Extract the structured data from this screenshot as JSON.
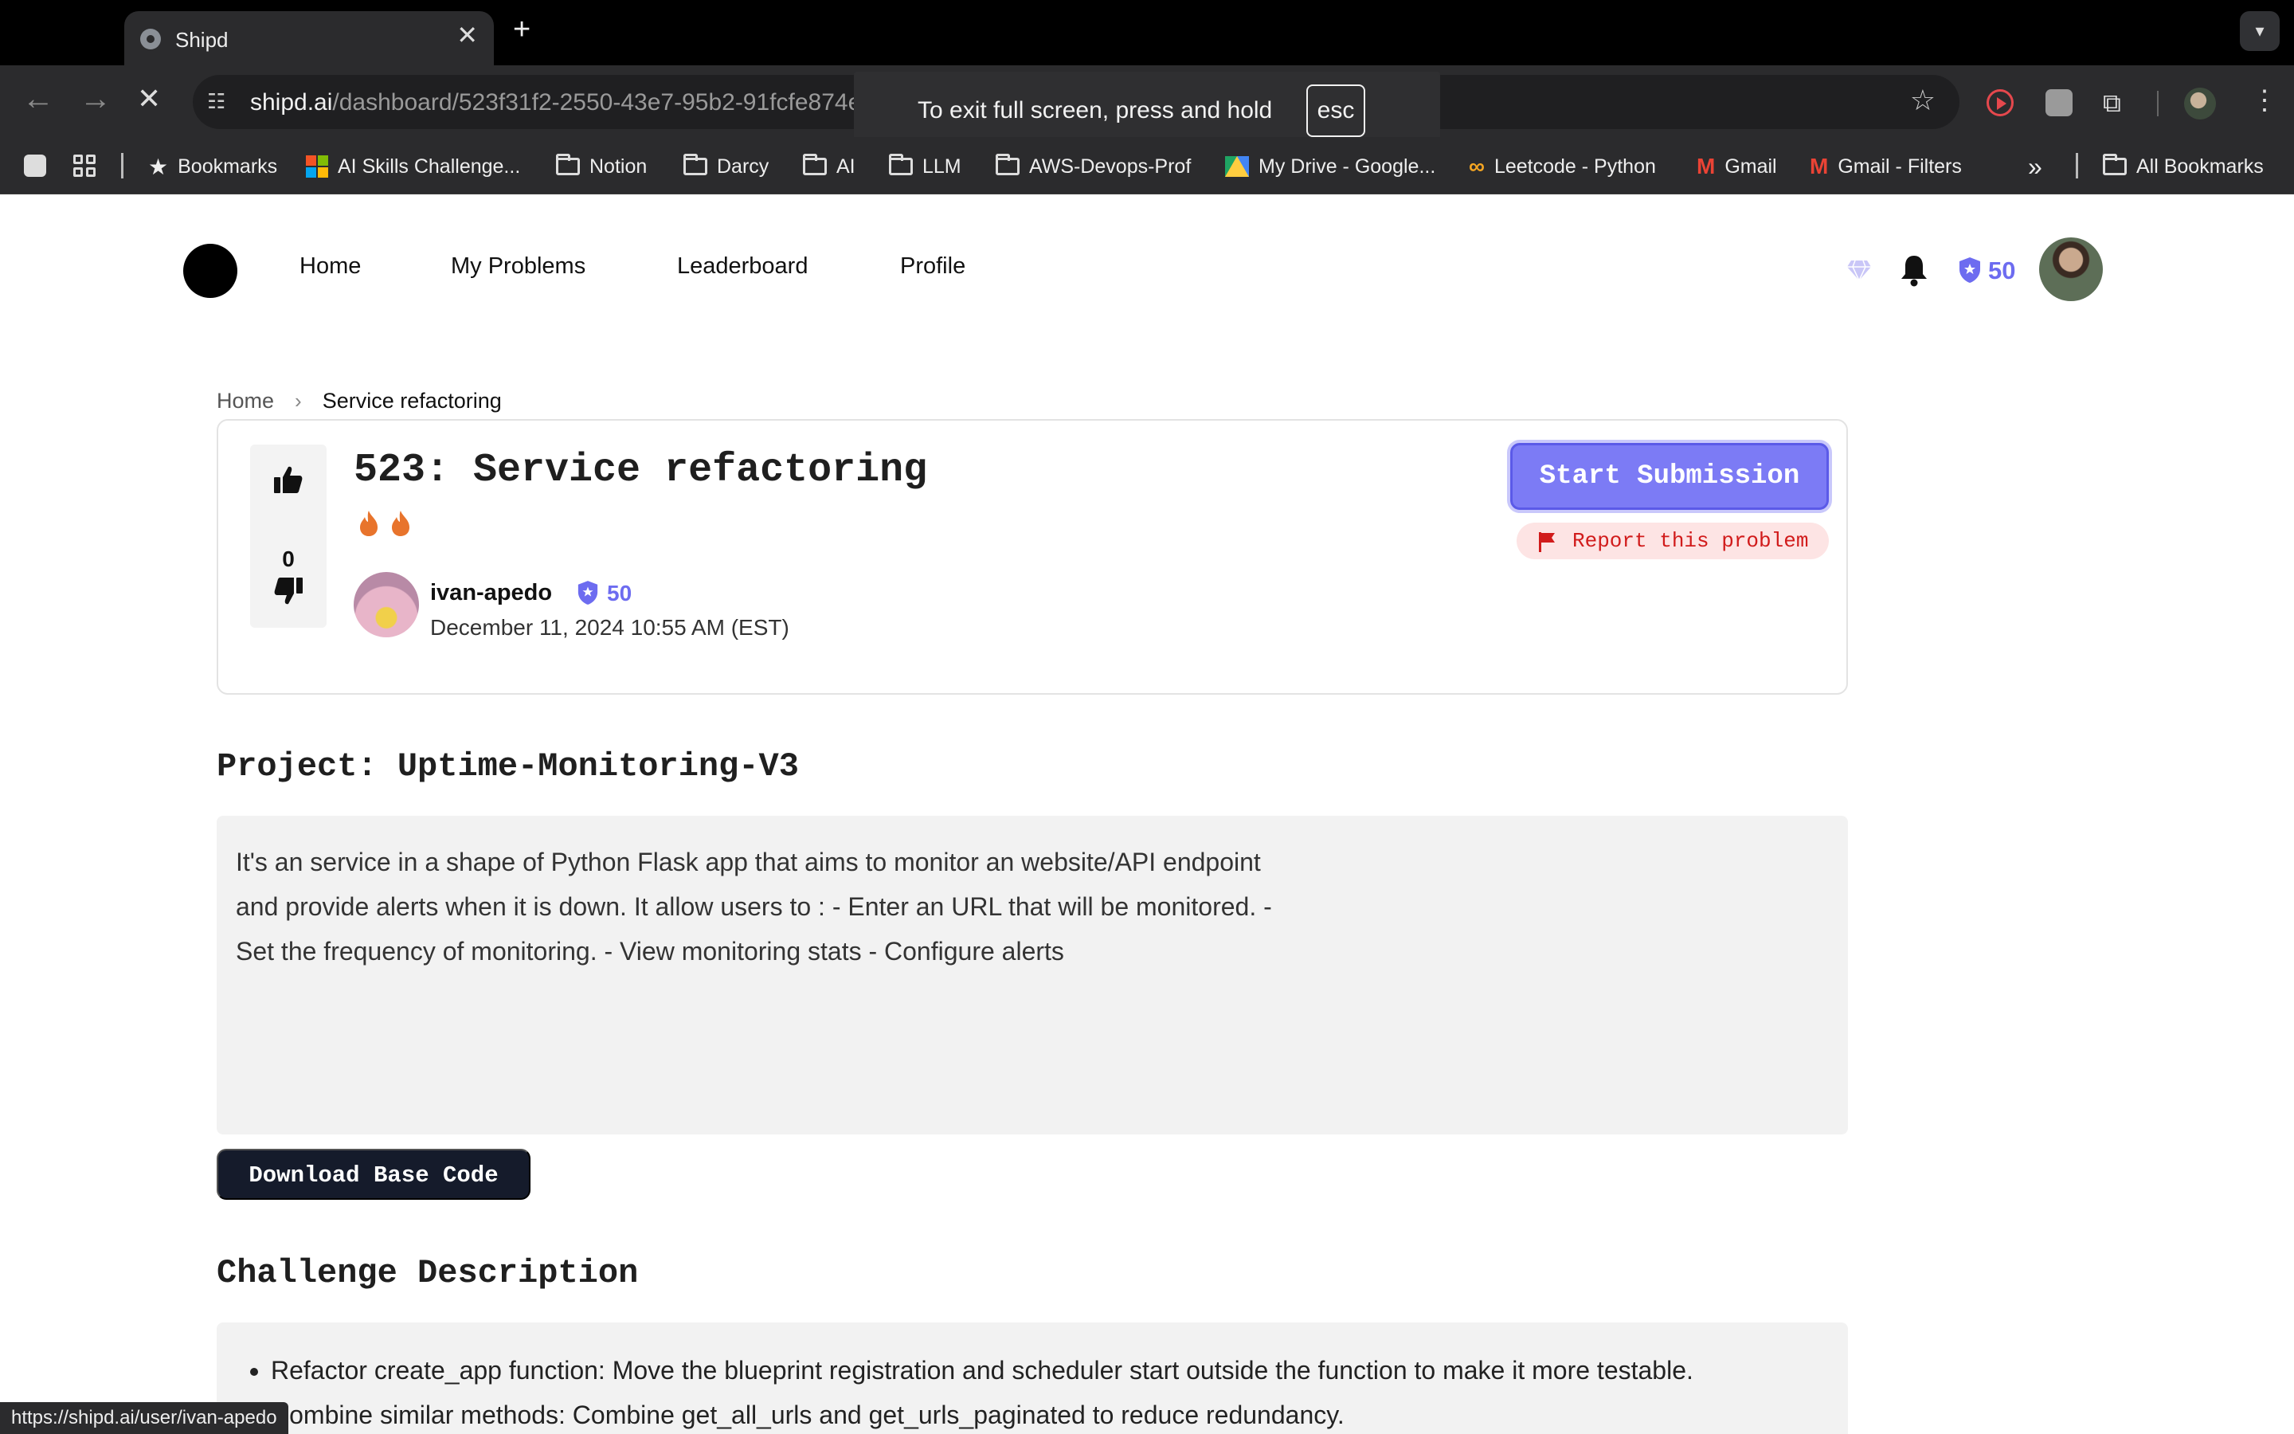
{
  "browser": {
    "tab_title": "Shipd",
    "tab_close": "✕",
    "new_tab": "+",
    "url_host": "shipd.ai",
    "url_path": "/dashboard/523f31f2-2550-43e7-95b2-91fcfe874ef2",
    "fullscreen_toast": "To exit full screen, press and hold",
    "fullscreen_key": "esc",
    "status_url": "https://shipd.ai/user/ivan-apedo",
    "bookmarks": [
      {
        "label": "Bookmarks",
        "icon": "star-icon"
      },
      {
        "label": "AI Skills Challenge...",
        "icon": "microsoft-icon"
      },
      {
        "label": "Notion",
        "icon": "folder-icon"
      },
      {
        "label": "Darcy",
        "icon": "folder-icon"
      },
      {
        "label": "AI",
        "icon": "folder-icon"
      },
      {
        "label": "LLM",
        "icon": "folder-icon"
      },
      {
        "label": "AWS-Devops-Prof",
        "icon": "folder-icon"
      },
      {
        "label": "My Drive - Google...",
        "icon": "google-drive-icon"
      },
      {
        "label": "Leetcode - Python",
        "icon": "leetcode-icon"
      },
      {
        "label": "Gmail",
        "icon": "gmail-icon"
      },
      {
        "label": "Gmail - Filters",
        "icon": "gmail-icon"
      }
    ],
    "bookmarks_overflow": "»",
    "all_bookmarks": "All Bookmarks"
  },
  "nav": {
    "links": [
      "Home",
      "My Problems",
      "Leaderboard",
      "Profile"
    ],
    "score": "50"
  },
  "breadcrumb": {
    "home": "Home",
    "separator": "›",
    "current": "Service refactoring"
  },
  "problem": {
    "title": "523: Service refactoring",
    "votes": "0",
    "difficulty_flames": 2,
    "author": "ivan-apedo",
    "author_score": "50",
    "date": "December 11, 2024 10:55 AM (EST)",
    "start_button": "Start Submission",
    "report_button": "Report this problem"
  },
  "project": {
    "heading": "Project: Uptime-Monitoring-V3",
    "description": "It's an service in a shape of Python Flask app that aims to monitor an website/API endpoint and provide alerts when it is down. It allow users to : - Enter an URL that will be monitored. - Set the frequency of monitoring. - View monitoring stats - Configure alerts",
    "download_button": "Download Base Code"
  },
  "challenge": {
    "heading": "Challenge Description",
    "items": [
      "Refactor create_app function: Move the blueprint registration and scheduler start outside the function to make it more testable.",
      "Combine similar methods: Combine get_all_urls and get_urls_paginated to reduce redundancy."
    ]
  },
  "colors": {
    "accent": "#7c7bf5",
    "score": "#6d6cf0",
    "report": "#d11b1b",
    "flame": "#e8742c"
  }
}
